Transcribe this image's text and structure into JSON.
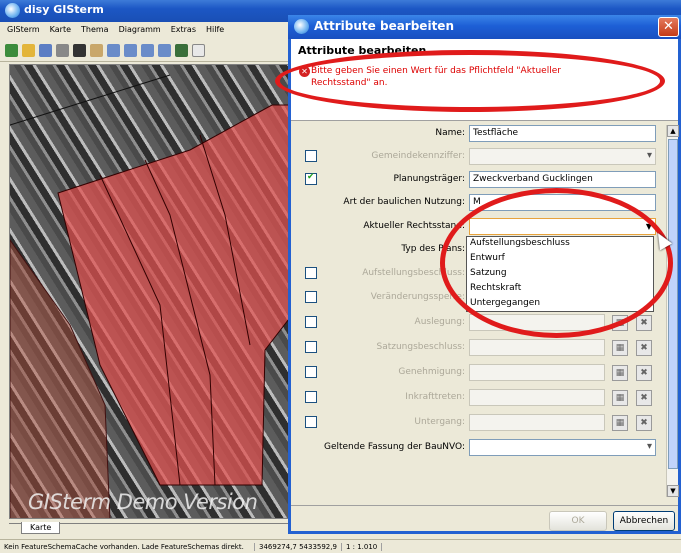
{
  "main_window": {
    "title": "disy GISterm",
    "menu": [
      "GISterm",
      "Karte",
      "Thema",
      "Diagramm",
      "Extras",
      "Hilfe"
    ],
    "watermark": "GISterm Demo Version",
    "tab": "Karte",
    "status": [
      "Kein FeatureSchemaCache vorhanden. Lade FeatureSchemas direkt.",
      "3469274,7  5433592,9",
      "1 : 1.010"
    ]
  },
  "dialog": {
    "title": "Attribute bearbeiten",
    "heading": "Attribute bearbeiten",
    "error_message": "Bitte geben Sie einen Wert für das Pflichtfeld \"Aktueller Rechtsstand\" an.",
    "fields": {
      "name_label": "Name:",
      "name_value": "Testfläche",
      "gemeinde_label": "Gemeindekennziffer:",
      "planungstraeger_label": "Planungsträger:",
      "planungstraeger_value": "Zweckverband Gucklingen",
      "nutzung_label": "Art der baulichen Nutzung:",
      "nutzung_value": "M",
      "rechtsstand_label": "Aktueller Rechtsstand:",
      "typ_label": "Typ des Plans:",
      "aufstellung_label": "Aufstellungsbeschluss:",
      "veraenderung_label": "Veränderungssperre:",
      "auslegung_label": "Auslegung:",
      "satzung_label": "Satzungsbeschluss:",
      "genehmigung_label": "Genehmigung:",
      "inkraft_label": "Inkrafttreten:",
      "untergang_label": "Untergang:",
      "baunvo_label": "Geltende Fassung der BauNVO:"
    },
    "rechtsstand_options": [
      "Aufstellungsbeschluss",
      "Entwurf",
      "Satzung",
      "Rechtskraft",
      "Untergegangen"
    ],
    "ok_label": "OK",
    "cancel_label": "Abbrechen"
  },
  "colors": {
    "annotation": "#e01b1b",
    "parcel_fill": "#e2504f"
  }
}
